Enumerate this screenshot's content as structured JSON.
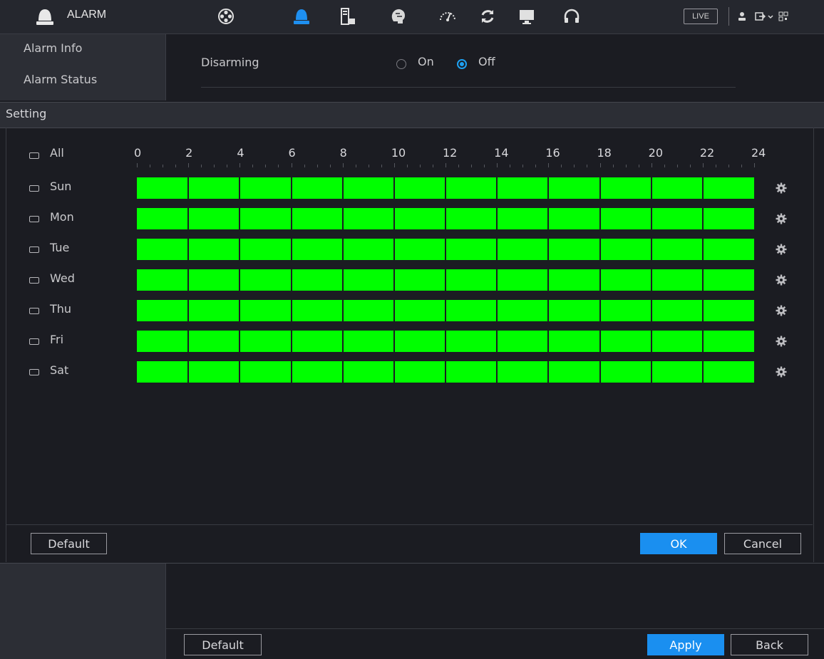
{
  "topbar": {
    "title": "ALARM",
    "live_label": "LIVE",
    "icons": [
      "alarm-logo-icon",
      "film-reel-icon",
      "alarm-light-icon",
      "storage-icon",
      "brain-icon",
      "performance-icon",
      "refresh-icon",
      "monitor-icon",
      "headset-icon",
      "user-icon",
      "logout-icon",
      "qr-code-icon"
    ]
  },
  "sidebar": {
    "items": [
      {
        "label": "Alarm Info"
      },
      {
        "label": "Alarm Status"
      }
    ]
  },
  "disarming": {
    "label": "Disarming",
    "options": [
      {
        "label": "On",
        "selected": false
      },
      {
        "label": "Off",
        "selected": true
      }
    ]
  },
  "setting": {
    "title": "Setting",
    "all_label": "All",
    "hours": [
      "0",
      "2",
      "4",
      "6",
      "8",
      "10",
      "12",
      "14",
      "16",
      "18",
      "20",
      "22",
      "24"
    ],
    "days": [
      {
        "label": "Sun",
        "armed_from_hour": 0,
        "armed_to_hour": 24
      },
      {
        "label": "Mon",
        "armed_from_hour": 0,
        "armed_to_hour": 24
      },
      {
        "label": "Tue",
        "armed_from_hour": 0,
        "armed_to_hour": 24
      },
      {
        "label": "Wed",
        "armed_from_hour": 0,
        "armed_to_hour": 24
      },
      {
        "label": "Thu",
        "armed_from_hour": 0,
        "armed_to_hour": 24
      },
      {
        "label": "Fri",
        "armed_from_hour": 0,
        "armed_to_hour": 24
      },
      {
        "label": "Sat",
        "armed_from_hour": 0,
        "armed_to_hour": 24
      }
    ],
    "bar_color": "#00ff00",
    "default_label": "Default",
    "ok_label": "OK",
    "cancel_label": "Cancel"
  },
  "footer": {
    "default_label": "Default",
    "apply_label": "Apply",
    "back_label": "Back"
  },
  "colors": {
    "accent": "#1a8ff0",
    "background": "#1b1c22"
  }
}
